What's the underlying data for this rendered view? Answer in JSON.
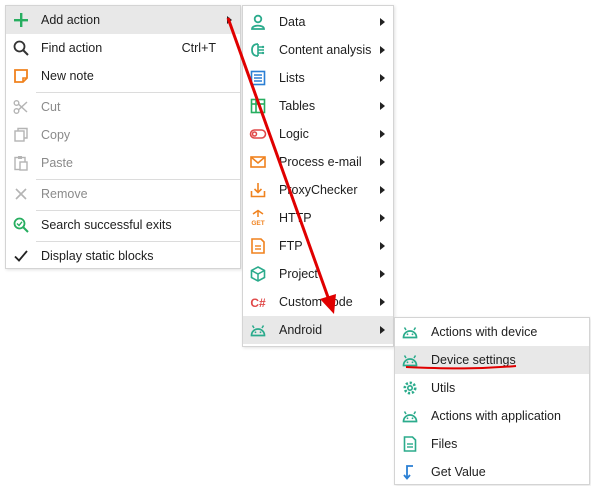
{
  "colors": {
    "accent_green": "#27ae60",
    "android_green": "#2bab8c",
    "orange": "#f0821e",
    "blue": "#2a7fd4",
    "red": "#e00000",
    "disabled_gray": "#b4b4b4"
  },
  "context_menu": {
    "items": [
      {
        "label": "Add action",
        "icon": "plus-icon",
        "submenu": true
      },
      {
        "label": "Find action",
        "icon": "search-icon",
        "shortcut": "Ctrl+T"
      },
      {
        "label": "New note",
        "icon": "note-icon"
      },
      {
        "label": "Cut",
        "icon": "scissors-icon",
        "disabled": true
      },
      {
        "label": "Copy",
        "icon": "copy-icon",
        "disabled": true
      },
      {
        "label": "Paste",
        "icon": "paste-icon",
        "disabled": true
      },
      {
        "label": "Remove",
        "icon": "close-icon",
        "disabled": true
      },
      {
        "label": "Search successful exits",
        "icon": "search-check-icon"
      },
      {
        "label": "Display static blocks",
        "icon": "checkmark-icon"
      }
    ]
  },
  "add_action_menu": {
    "items": [
      {
        "label": "Data",
        "icon": "user-icon"
      },
      {
        "label": "Content analysis",
        "icon": "brain-icon"
      },
      {
        "label": "Lists",
        "icon": "list-icon"
      },
      {
        "label": "Tables",
        "icon": "table-icon"
      },
      {
        "label": "Logic",
        "icon": "toggle-icon"
      },
      {
        "label": "Process e-mail",
        "icon": "envelope-icon"
      },
      {
        "label": "ProxyChecker",
        "icon": "download-icon"
      },
      {
        "label": "HTTP",
        "icon": "http-get-icon",
        "icon_text": "GET"
      },
      {
        "label": "FTP",
        "icon": "ftp-file-icon"
      },
      {
        "label": "Project",
        "icon": "cube-icon"
      },
      {
        "label": "Custom code",
        "icon": "csharp-icon",
        "icon_text": "C#"
      },
      {
        "label": "Android",
        "icon": "android-icon"
      }
    ]
  },
  "android_menu": {
    "items": [
      {
        "label": "Actions with device",
        "icon": "android-icon"
      },
      {
        "label": "Device settings",
        "icon": "android-icon"
      },
      {
        "label": "Utils",
        "icon": "gear-icon"
      },
      {
        "label": "Actions with application",
        "icon": "android-icon"
      },
      {
        "label": "Files",
        "icon": "file-icon"
      },
      {
        "label": "Get Value",
        "icon": "get-value-icon"
      }
    ]
  }
}
